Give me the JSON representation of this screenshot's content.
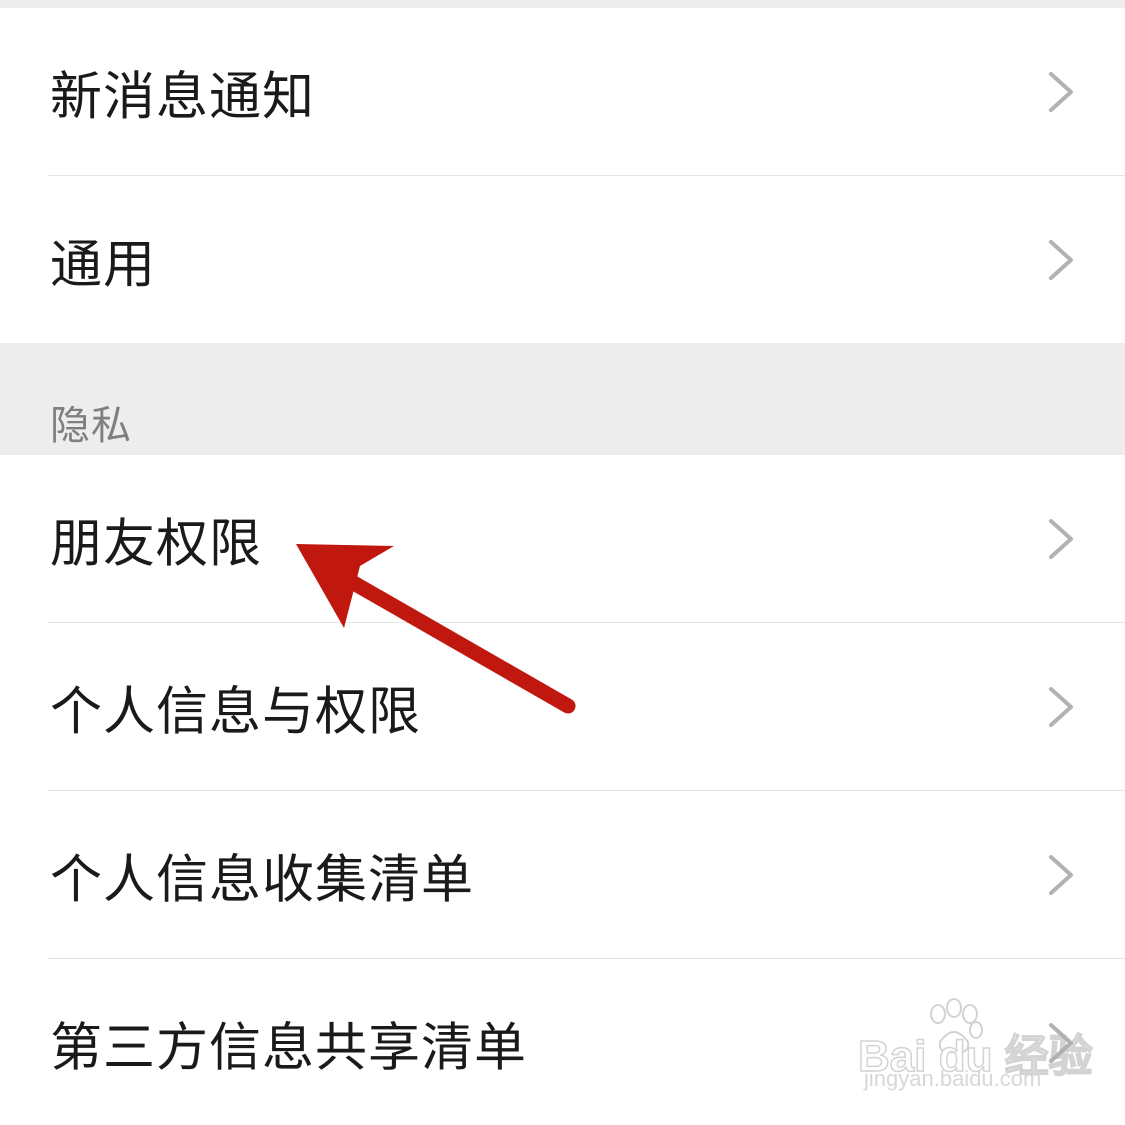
{
  "settings": {
    "group1": [
      {
        "label": "新消息通知"
      },
      {
        "label": "通用"
      }
    ],
    "privacy_header": "隐私",
    "group2": [
      {
        "label": "朋友权限"
      },
      {
        "label": "个人信息与权限"
      },
      {
        "label": "个人信息收集清单"
      },
      {
        "label": "第三方信息共享清单"
      }
    ]
  },
  "annotation": {
    "arrow_color": "#c0170f",
    "points_to": "朋友权限"
  },
  "watermark": {
    "brand": "Bai du 经验",
    "url": "jingyan.baidu.com"
  },
  "colors": {
    "background": "#ffffff",
    "section_bg": "#ededed",
    "text": "#1a1a1a",
    "secondary_text": "#7f7f7f",
    "chevron": "#b2b2b2",
    "divider": "#e5e5e5"
  },
  "icons": {
    "row_chevron": "chevron-right-icon",
    "watermark_logo": "paw-icon"
  }
}
